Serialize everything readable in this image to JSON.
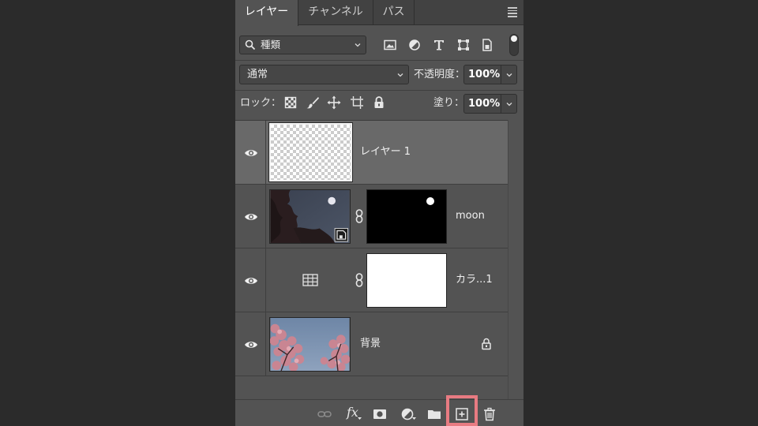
{
  "tabs": [
    {
      "label": "レイヤー",
      "active": true
    },
    {
      "label": "チャンネル",
      "active": false
    },
    {
      "label": "パス",
      "active": false
    }
  ],
  "filter": {
    "kind_label": "種類",
    "icons": [
      "image-filter-icon",
      "adjustment-filter-icon",
      "type-filter-icon",
      "shape-filter-icon",
      "smart-object-filter-icon"
    ]
  },
  "blend": {
    "mode": "通常",
    "opacity_label": "不透明度：",
    "opacity_value": "100%"
  },
  "lock": {
    "label": "ロック：",
    "icons": [
      "lock-transparent-pixels-icon",
      "lock-image-pixels-icon",
      "lock-position-icon",
      "lock-artboard-icon",
      "lock-all-icon"
    ],
    "fill_label": "塗り：",
    "fill_value": "100%"
  },
  "layers": [
    {
      "name": "レイヤー 1",
      "selected": true,
      "type": "pixel"
    },
    {
      "name": "moon",
      "selected": false,
      "type": "smart-object-with-mask"
    },
    {
      "name": "カラ...1",
      "selected": false,
      "type": "adjustment-with-mask"
    },
    {
      "name": "背景",
      "selected": false,
      "type": "background",
      "locked": true
    }
  ],
  "bottom_icons": [
    "link-layers-icon",
    "fx-icon",
    "add-mask-icon",
    "new-adjustment-layer-icon",
    "new-group-icon",
    "new-layer-icon",
    "delete-layer-icon"
  ],
  "fx_label": "fx",
  "colors": {
    "panel": "#535353",
    "selected_row": "#696969",
    "highlight": "#e87b82",
    "background": "#2b2b2b"
  }
}
